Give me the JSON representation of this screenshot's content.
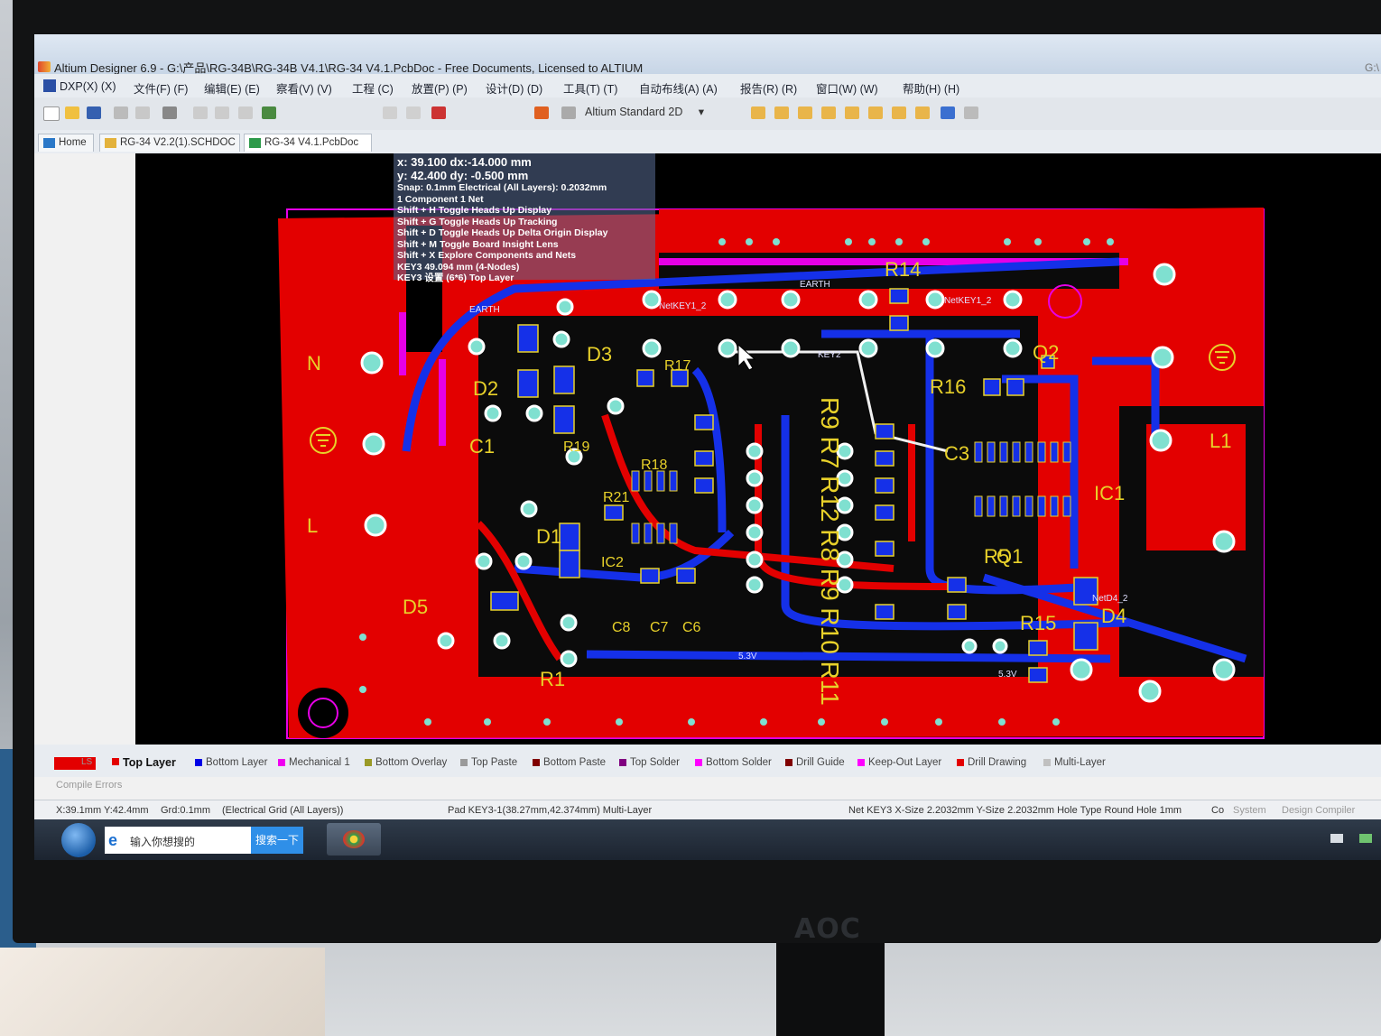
{
  "window": {
    "title": "Altium Designer 6.9 - G:\\产品\\RG-34B\\RG-34B V4.1\\RG-34 V4.1.PcbDoc - Free Documents, Licensed to ALTIUM",
    "title_right": "G:\\"
  },
  "menu": {
    "items": [
      "DXP(X) (X)",
      "文件(F) (F)",
      "编辑(E) (E)",
      "察看(V) (V)",
      "工程 (C)",
      "放置(P) (P)",
      "设计(D) (D)",
      "工具(T) (T)",
      "自动布线(A) (A)",
      "报告(R) (R)",
      "窗口(W) (W)",
      "帮助(H) (H)"
    ]
  },
  "toolbar": {
    "view_mode": "Altium Standard 2D",
    "view_dropdown": "▾"
  },
  "doc_tabs": [
    "Home",
    "RG-34 V2.2(1).SCHDOC",
    "RG-34 V4.1.PcbDoc"
  ],
  "hud": {
    "line1": "x: 39.100   dx:-14.000  mm",
    "line2": "y: 42.400   dy: -0.500   mm",
    "line3": "Snap: 0.1mm Electrical (All Layers): 0.2032mm",
    "line4": "1 Component 1 Net",
    "line5": "Shift + H   Toggle Heads Up Display",
    "line6": "Shift + G   Toggle Heads Up Tracking",
    "line7": "Shift + D   Toggle Heads Up Delta Origin Display",
    "line8": "Shift + M   Toggle Board Insight Lens",
    "line9": "Shift + X   Explore Components and Nets",
    "line10": "KEY3   49.094 mm  (4-Nodes)",
    "line11": "KEY3  设置 (6*6) Top Layer"
  },
  "pcb_labels": {
    "n": "N",
    "l": "L",
    "l1": "L1",
    "d1": "D1",
    "d2": "D2",
    "d3": "D3",
    "d4": "D4",
    "d5": "D5",
    "c1": "C1",
    "c3": "C3",
    "c6": "C6",
    "c7": "C7",
    "c8": "C8",
    "r1": "R1",
    "r5": "R5",
    "r14": "R14",
    "r15": "R15",
    "r16": "R16",
    "r17": "R17",
    "r18": "R18",
    "r19": "R19",
    "r21": "R21",
    "q1": "Q1",
    "q2": "Q2",
    "ic1": "IC1",
    "ic2": "IC2",
    "r_column": "R9 R7 R12 R8 R9 R10 R11",
    "earth": "EARTH",
    "key2": "KEY2",
    "netkey1": "NetKEY1_2",
    "v53": "5.3V",
    "netd4": "NetD4_2"
  },
  "layers": {
    "ls_label": "LS",
    "items": [
      {
        "label": "Top Layer",
        "color": "#e30000",
        "active": true
      },
      {
        "label": "Bottom Layer",
        "color": "#0000e6"
      },
      {
        "label": "Mechanical 1",
        "color": "#f000f0"
      },
      {
        "label": "Bottom Overlay",
        "color": "#9a9a26"
      },
      {
        "label": "Top Paste",
        "color": "#9a9a9a"
      },
      {
        "label": "Bottom Paste",
        "color": "#800000"
      },
      {
        "label": "Top Solder",
        "color": "#800080"
      },
      {
        "label": "Bottom Solder",
        "color": "#ff00ff"
      },
      {
        "label": "Drill Guide",
        "color": "#800000"
      },
      {
        "label": "Keep-Out Layer",
        "color": "#ff00ff"
      },
      {
        "label": "Drill Drawing",
        "color": "#e30000"
      },
      {
        "label": "Multi-Layer",
        "color": "#c0c0c0"
      }
    ],
    "compile_errors": "Compile Errors"
  },
  "status": {
    "coords": "X:39.1mm Y:42.4mm",
    "grid": "Grd:0.1mm",
    "elec": "(Electrical Grid (All Layers))",
    "pad": "Pad KEY3-1(38.27mm,42.374mm)  Multi-Layer",
    "net": "Net KEY3 X-Size 2.2032mm Y-Size 2.2032mm Hole Type Round Hole 1mm",
    "co": "Co",
    "system": "System",
    "design_compiler": "Design Compiler"
  },
  "taskbar": {
    "search_placeholder": "输入你想搜的",
    "search_button": "搜索一下"
  },
  "monitor": {
    "brand": "AOC"
  },
  "colors": {
    "top_layer": "#e30000",
    "bottom_layer": "#1530e8",
    "keepout": "#e600e6",
    "pad": "#7fe0d0",
    "overlay": "#e8d12a"
  }
}
